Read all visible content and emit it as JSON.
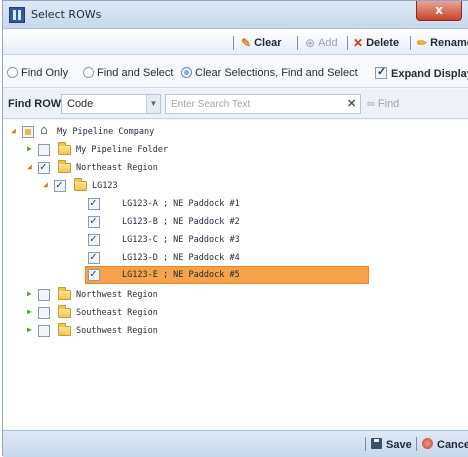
{
  "window": {
    "title": "Select ROWs",
    "close_label": "x"
  },
  "toolbar": {
    "clear_label": "Clear",
    "add_label": "Add",
    "delete_label": "Delete",
    "rename_label": "Rename"
  },
  "options": {
    "radios": [
      {
        "label": "Find Only",
        "selected": false
      },
      {
        "label": "Find and Select",
        "selected": false
      },
      {
        "label": "Clear Selections, Find and Select",
        "selected": true
      }
    ],
    "expand_display": {
      "label": "Expand Display",
      "checked": true
    }
  },
  "find": {
    "label": "Find ROW",
    "field_value": "Code",
    "search_placeholder": "Enter Search Text",
    "find_button": "Find"
  },
  "tree": {
    "root": "My Pipeline Company",
    "folder_1": "My Pipeline Folder",
    "northeast": "Northeast Region",
    "lg123": "LG123",
    "items": [
      "LG123-A ; NE Paddock #1",
      "LG123-B ; NE Paddock #2",
      "LG123-C ; NE Paddock #3",
      "LG123-D ; NE Paddock #4",
      "LG123-E ; NE Paddock #5"
    ],
    "northwest": "Northwest Region",
    "southeast": "Southeast Region",
    "southwest": "Southwest Region",
    "selected_item_index": 4,
    "highlight_color": "#f6a24a"
  },
  "footer": {
    "save_label": "Save",
    "cancel_label": "Cancel"
  }
}
